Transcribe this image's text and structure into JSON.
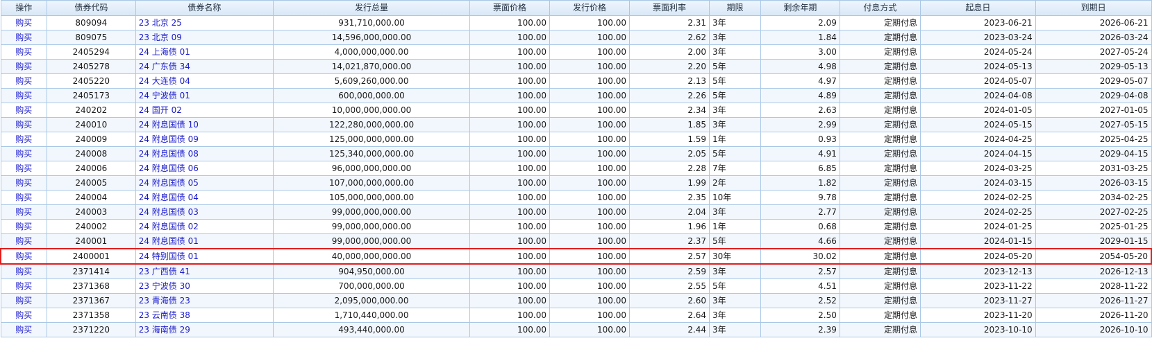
{
  "columns": [
    "操作",
    "债券代码",
    "债券名称",
    "发行总量",
    "票面价格",
    "发行价格",
    "票面利率",
    "期限",
    "剩余年期",
    "付息方式",
    "起息日",
    "到期日"
  ],
  "action_label": "购买",
  "highlight_color": "#e11d1d",
  "selected_row_index": 17,
  "rows": [
    {
      "code": "809094",
      "name": "23 北京 25",
      "total": "931,710,000.00",
      "face": "100.00",
      "issue_price": "100.00",
      "rate": "2.31",
      "term": "3年",
      "remaining": "2.09",
      "payment": "定期付息",
      "start": "2023-06-21",
      "end": "2026-06-21"
    },
    {
      "code": "809075",
      "name": "23 北京 09",
      "total": "14,596,000,000.00",
      "face": "100.00",
      "issue_price": "100.00",
      "rate": "2.62",
      "term": "3年",
      "remaining": "1.84",
      "payment": "定期付息",
      "start": "2023-03-24",
      "end": "2026-03-24"
    },
    {
      "code": "2405294",
      "name": "24 上海债 01",
      "total": "4,000,000,000.00",
      "face": "100.00",
      "issue_price": "100.00",
      "rate": "2.00",
      "term": "3年",
      "remaining": "3.00",
      "payment": "定期付息",
      "start": "2024-05-24",
      "end": "2027-05-24"
    },
    {
      "code": "2405278",
      "name": "24 广东债 34",
      "total": "14,021,870,000.00",
      "face": "100.00",
      "issue_price": "100.00",
      "rate": "2.20",
      "term": "5年",
      "remaining": "4.98",
      "payment": "定期付息",
      "start": "2024-05-13",
      "end": "2029-05-13"
    },
    {
      "code": "2405220",
      "name": "24 大连债 04",
      "total": "5,609,260,000.00",
      "face": "100.00",
      "issue_price": "100.00",
      "rate": "2.13",
      "term": "5年",
      "remaining": "4.97",
      "payment": "定期付息",
      "start": "2024-05-07",
      "end": "2029-05-07"
    },
    {
      "code": "2405173",
      "name": "24 宁波债 01",
      "total": "600,000,000.00",
      "face": "100.00",
      "issue_price": "100.00",
      "rate": "2.26",
      "term": "5年",
      "remaining": "4.89",
      "payment": "定期付息",
      "start": "2024-04-08",
      "end": "2029-04-08"
    },
    {
      "code": "240202",
      "name": "24 国开 02",
      "total": "10,000,000,000.00",
      "face": "100.00",
      "issue_price": "100.00",
      "rate": "2.34",
      "term": "3年",
      "remaining": "2.63",
      "payment": "定期付息",
      "start": "2024-01-05",
      "end": "2027-01-05"
    },
    {
      "code": "240010",
      "name": "24 附息国债 10",
      "total": "122,280,000,000.00",
      "face": "100.00",
      "issue_price": "100.00",
      "rate": "1.85",
      "term": "3年",
      "remaining": "2.99",
      "payment": "定期付息",
      "start": "2024-05-15",
      "end": "2027-05-15"
    },
    {
      "code": "240009",
      "name": "24 附息国债 09",
      "total": "125,000,000,000.00",
      "face": "100.00",
      "issue_price": "100.00",
      "rate": "1.59",
      "term": "1年",
      "remaining": "0.93",
      "payment": "定期付息",
      "start": "2024-04-25",
      "end": "2025-04-25"
    },
    {
      "code": "240008",
      "name": "24 附息国债 08",
      "total": "125,340,000,000.00",
      "face": "100.00",
      "issue_price": "100.00",
      "rate": "2.05",
      "term": "5年",
      "remaining": "4.91",
      "payment": "定期付息",
      "start": "2024-04-15",
      "end": "2029-04-15"
    },
    {
      "code": "240006",
      "name": "24 附息国债 06",
      "total": "96,000,000,000.00",
      "face": "100.00",
      "issue_price": "100.00",
      "rate": "2.28",
      "term": "7年",
      "remaining": "6.85",
      "payment": "定期付息",
      "start": "2024-03-25",
      "end": "2031-03-25"
    },
    {
      "code": "240005",
      "name": "24 附息国债 05",
      "total": "107,000,000,000.00",
      "face": "100.00",
      "issue_price": "100.00",
      "rate": "1.99",
      "term": "2年",
      "remaining": "1.82",
      "payment": "定期付息",
      "start": "2024-03-15",
      "end": "2026-03-15"
    },
    {
      "code": "240004",
      "name": "24 附息国债 04",
      "total": "105,000,000,000.00",
      "face": "100.00",
      "issue_price": "100.00",
      "rate": "2.35",
      "term": "10年",
      "remaining": "9.78",
      "payment": "定期付息",
      "start": "2024-02-25",
      "end": "2034-02-25"
    },
    {
      "code": "240003",
      "name": "24 附息国债 03",
      "total": "99,000,000,000.00",
      "face": "100.00",
      "issue_price": "100.00",
      "rate": "2.04",
      "term": "3年",
      "remaining": "2.77",
      "payment": "定期付息",
      "start": "2024-02-25",
      "end": "2027-02-25"
    },
    {
      "code": "240002",
      "name": "24 附息国债 02",
      "total": "99,000,000,000.00",
      "face": "100.00",
      "issue_price": "100.00",
      "rate": "1.96",
      "term": "1年",
      "remaining": "0.68",
      "payment": "定期付息",
      "start": "2024-01-25",
      "end": "2025-01-25"
    },
    {
      "code": "240001",
      "name": "24 附息国债 01",
      "total": "99,000,000,000.00",
      "face": "100.00",
      "issue_price": "100.00",
      "rate": "2.37",
      "term": "5年",
      "remaining": "4.66",
      "payment": "定期付息",
      "start": "2024-01-15",
      "end": "2029-01-15"
    },
    {
      "code": "2400001",
      "name": "24 特别国债 01",
      "total": "40,000,000,000.00",
      "face": "100.00",
      "issue_price": "100.00",
      "rate": "2.57",
      "term": "30年",
      "remaining": "30.02",
      "payment": "定期付息",
      "start": "2024-05-20",
      "end": "2054-05-20"
    },
    {
      "code": "2371414",
      "name": "23 广西债 41",
      "total": "904,950,000.00",
      "face": "100.00",
      "issue_price": "100.00",
      "rate": "2.59",
      "term": "3年",
      "remaining": "2.57",
      "payment": "定期付息",
      "start": "2023-12-13",
      "end": "2026-12-13"
    },
    {
      "code": "2371368",
      "name": "23 宁波债 30",
      "total": "700,000,000.00",
      "face": "100.00",
      "issue_price": "100.00",
      "rate": "2.55",
      "term": "5年",
      "remaining": "4.51",
      "payment": "定期付息",
      "start": "2023-11-22",
      "end": "2028-11-22"
    },
    {
      "code": "2371367",
      "name": "23 青海债 23",
      "total": "2,095,000,000.00",
      "face": "100.00",
      "issue_price": "100.00",
      "rate": "2.60",
      "term": "3年",
      "remaining": "2.52",
      "payment": "定期付息",
      "start": "2023-11-27",
      "end": "2026-11-27"
    },
    {
      "code": "2371358",
      "name": "23 云南债 38",
      "total": "1,710,440,000.00",
      "face": "100.00",
      "issue_price": "100.00",
      "rate": "2.64",
      "term": "3年",
      "remaining": "2.50",
      "payment": "定期付息",
      "start": "2023-11-20",
      "end": "2026-11-20"
    },
    {
      "code": "2371220",
      "name": "23 海南债 29",
      "total": "493,440,000.00",
      "face": "100.00",
      "issue_price": "100.00",
      "rate": "2.44",
      "term": "3年",
      "remaining": "2.39",
      "payment": "定期付息",
      "start": "2023-10-10",
      "end": "2026-10-10"
    }
  ]
}
